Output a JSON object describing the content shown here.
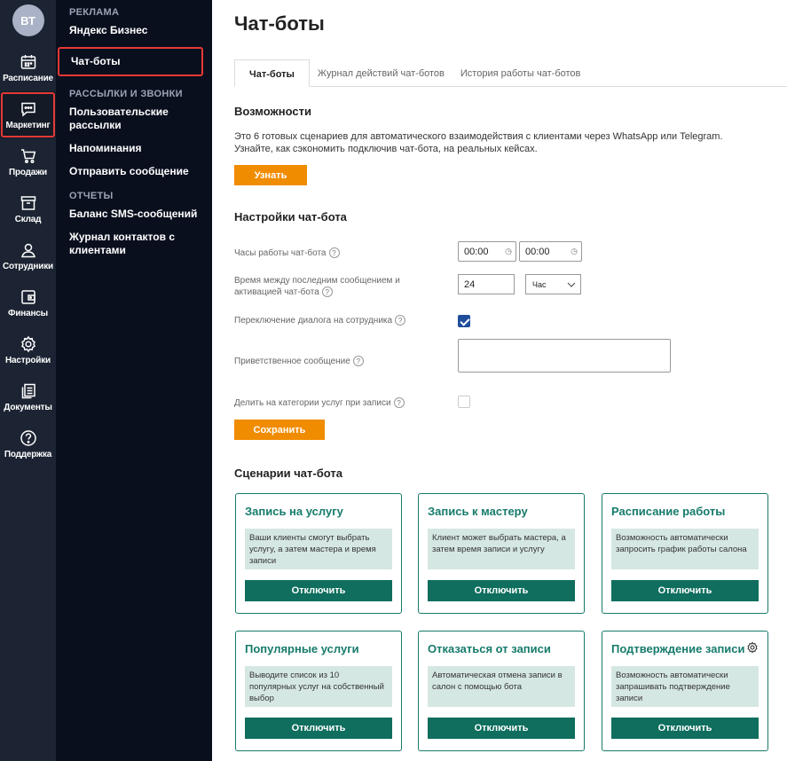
{
  "rail": {
    "avatar": "ВТ",
    "items": [
      {
        "label": "Расписание",
        "icon": "calendar-icon"
      },
      {
        "label": "Маркетинг",
        "icon": "chat-icon",
        "active": true
      },
      {
        "label": "Продажи",
        "icon": "cart-icon"
      },
      {
        "label": "Склад",
        "icon": "box-icon"
      },
      {
        "label": "Сотрудники",
        "icon": "user-icon"
      },
      {
        "label": "Финансы",
        "icon": "wallet-icon"
      },
      {
        "label": "Настройки",
        "icon": "gear-icon"
      },
      {
        "label": "Документы",
        "icon": "documents-icon"
      },
      {
        "label": "Поддержка",
        "icon": "help-icon"
      }
    ]
  },
  "subnav": {
    "sections": [
      {
        "title": "РЕКЛАМА",
        "links": [
          "Яндекс Бизнес",
          "Чат-боты"
        ]
      },
      {
        "title": "РАССЫЛКИ И ЗВОНКИ",
        "links": [
          "Пользовательские рассылки",
          "Напоминания",
          "Отправить сообщение"
        ]
      },
      {
        "title": "ОТЧЕТЫ",
        "links": [
          "Баланс SMS-сообщений",
          "Журнал контактов с клиентами"
        ]
      }
    ],
    "active_link": "Чат-боты"
  },
  "page": {
    "title": "Чат-боты",
    "tabs": [
      "Чат-боты",
      "Журнал действий чат-ботов",
      "История работы чат-ботов"
    ],
    "active_tab": "Чат-боты"
  },
  "features": {
    "heading": "Возможности",
    "line1": "Это 6 готовых сценариев для автоматического взаимодействия с клиентами через WhatsApp или Telegram.",
    "line2": "Узнайте, как сэкономить подключив чат-бота, на реальных кейсах.",
    "button": "Узнать"
  },
  "settings": {
    "heading": "Настройки чат-бота",
    "hours_label": "Часы работы чат-бота",
    "hours_from": "00:00",
    "hours_to": "00:00",
    "delay_label_1": "Время между последним сообщением и",
    "delay_label_2": "активацией чат-бота",
    "delay_value": "24",
    "delay_unit": "Час",
    "switch_label": "Переключение диалога на сотрудника",
    "switch_checked": true,
    "greeting_label": "Приветственное сообщение",
    "greeting_value": "",
    "categories_label": "Делить на категории услуг при записи",
    "categories_checked": false,
    "save_button": "Сохранить"
  },
  "scenarios": {
    "heading": "Сценарии чат-бота",
    "cards": [
      {
        "title": "Запись на услугу",
        "desc": "Ваши клиенты смогут выбрать услугу, а затем мастера и время записи",
        "button": "Отключить"
      },
      {
        "title": "Запись к мастеру",
        "desc": "Клиент может выбрать мастера, а затем время записи и услугу",
        "button": "Отключить"
      },
      {
        "title": "Расписание работы",
        "desc": "Возможность автоматически запросить график работы салона",
        "button": "Отключить"
      },
      {
        "title": "Популярные услуги",
        "desc": "Выводите список из 10 популярных услуг на собственный выбор",
        "button": "Отключить"
      },
      {
        "title": "Отказаться от записи",
        "desc": "Автоматическая отмена записи в салон с помощью бота",
        "button": "Отключить"
      },
      {
        "title": "Подтверждение записи",
        "desc": "Возможность автоматически запрашивать подтверждение записи",
        "button": "Отключить",
        "has_settings": true
      }
    ]
  },
  "colors": {
    "rail_bg": "#1c2433",
    "subnav_bg": "#0a0f1e",
    "accent_orange": "#f08c00",
    "accent_green": "#167b6b",
    "highlight_red": "#e53935"
  }
}
